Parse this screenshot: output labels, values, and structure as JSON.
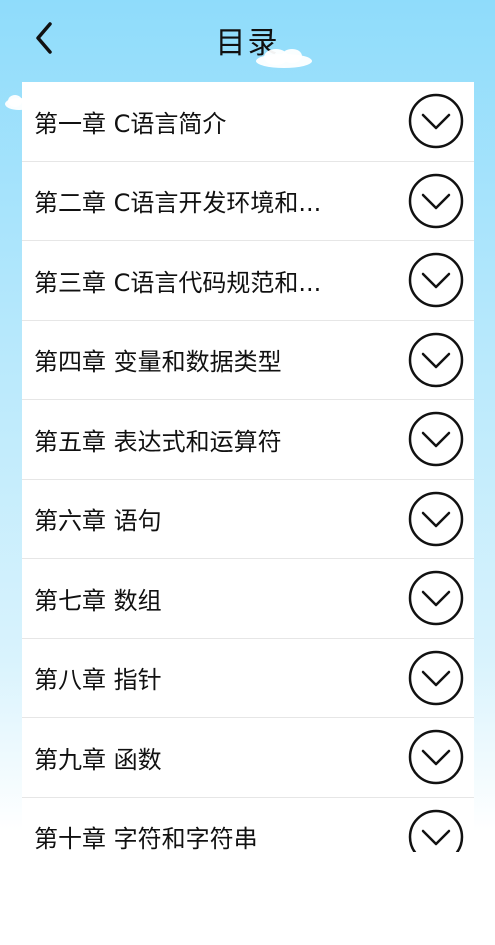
{
  "header": {
    "title": "目录",
    "back_icon": "chevron-left-icon"
  },
  "chapters": [
    {
      "label": "第一章 C语言简介"
    },
    {
      "label": "第二章 C语言开发环境和..."
    },
    {
      "label": "第三章 C语言代码规范和..."
    },
    {
      "label": "第四章 变量和数据类型"
    },
    {
      "label": "第五章 表达式和运算符"
    },
    {
      "label": "第六章 语句"
    },
    {
      "label": "第七章 数组"
    },
    {
      "label": "第八章 指针"
    },
    {
      "label": "第九章 函数"
    },
    {
      "label": "第十章 字符和字符串"
    }
  ],
  "row_icon": "chevron-down-circle-icon",
  "colors": {
    "sky_top": "#8fdcfb",
    "sky_bottom": "#ffffff",
    "text": "#111111",
    "divider": "#e6e6e6"
  }
}
